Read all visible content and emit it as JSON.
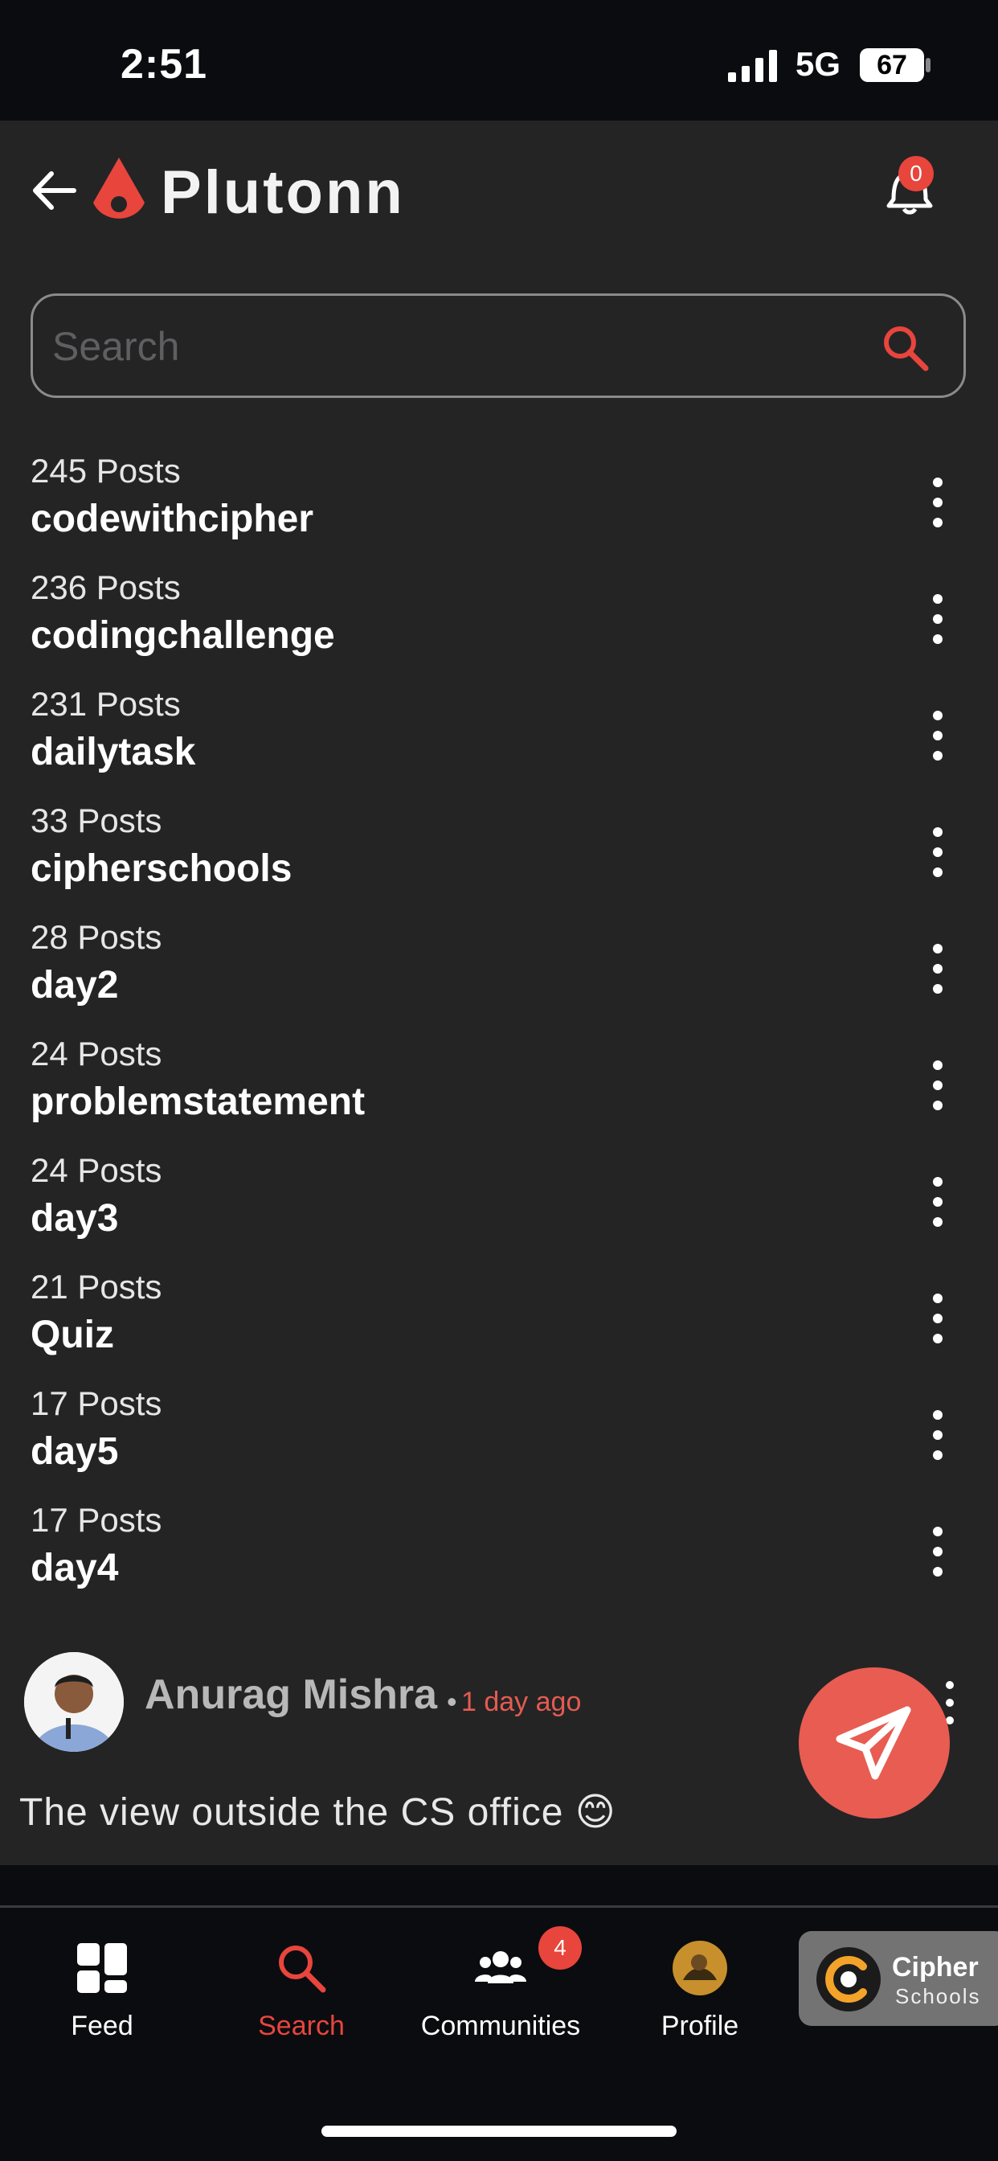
{
  "status": {
    "time": "2:51",
    "network": "5G",
    "battery": "67"
  },
  "header": {
    "logo_text": "Plutonn",
    "notification_count": "0"
  },
  "search": {
    "placeholder": "Search"
  },
  "tags": [
    {
      "count": "245 Posts",
      "name": "codewithcipher"
    },
    {
      "count": "236 Posts",
      "name": "codingchallenge"
    },
    {
      "count": "231 Posts",
      "name": "dailytask"
    },
    {
      "count": "33 Posts",
      "name": "cipherschools"
    },
    {
      "count": "28 Posts",
      "name": "day2"
    },
    {
      "count": "24 Posts",
      "name": "problemstatement"
    },
    {
      "count": "24 Posts",
      "name": "day3"
    },
    {
      "count": "21 Posts",
      "name": "Quiz"
    },
    {
      "count": "17 Posts",
      "name": "day5"
    },
    {
      "count": "17 Posts",
      "name": "day4"
    }
  ],
  "post": {
    "author": "Anurag Mishra",
    "separator": "•",
    "time_ago": "1 day ago",
    "text": "The view outside the CS office 😊"
  },
  "tabbar": {
    "items": [
      {
        "label": "Feed",
        "icon": "grid-icon"
      },
      {
        "label": "Search",
        "icon": "search-icon"
      },
      {
        "label": "Communities",
        "icon": "people-icon"
      },
      {
        "label": "Profile",
        "icon": "avatar"
      }
    ],
    "communities_badge": "4",
    "active": "Search"
  },
  "cipher_badge": {
    "name": "Cipher",
    "sub": "Schools"
  },
  "colors": {
    "accent": "#e8453c",
    "background": "#242425",
    "tabbar": "#0b0c10"
  }
}
